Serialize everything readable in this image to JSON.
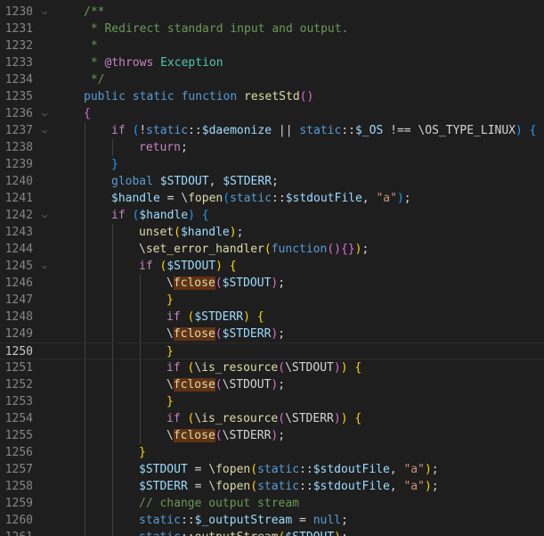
{
  "editor": {
    "language": "php",
    "current_line": 1250,
    "highlight_word": "fclose",
    "colors": {
      "background": "#1e1e1e",
      "comment": "#6a9955",
      "keyword": "#569cd6",
      "control": "#c586c0",
      "function": "#dcdcaa",
      "variable": "#9cdcfe",
      "string": "#ce9178",
      "bracket_1": "#ffd700",
      "bracket_2": "#da70d6",
      "bracket_3": "#179fff",
      "word_highlight": "#613214"
    },
    "lines": [
      {
        "n": "1230",
        "fold": "v",
        "indent": 1,
        "tokens": [
          [
            "comment",
            "/**"
          ]
        ]
      },
      {
        "n": "1231",
        "fold": "",
        "indent": 1,
        "tokens": [
          [
            "comment",
            " * Redirect standard input and output."
          ]
        ]
      },
      {
        "n": "1232",
        "fold": "",
        "indent": 1,
        "tokens": [
          [
            "comment",
            " *"
          ]
        ]
      },
      {
        "n": "1233",
        "fold": "",
        "indent": 1,
        "tokens": [
          [
            "comment",
            " * "
          ],
          [
            "ctl",
            "@throws"
          ],
          [
            "cls",
            " Exception"
          ]
        ]
      },
      {
        "n": "1234",
        "fold": "",
        "indent": 1,
        "tokens": [
          [
            "comment",
            " */"
          ]
        ]
      },
      {
        "n": "1235",
        "fold": "",
        "indent": 1,
        "tokens": [
          [
            "kw",
            "public"
          ],
          [
            "plain",
            " "
          ],
          [
            "kw",
            "static"
          ],
          [
            "plain",
            " "
          ],
          [
            "kw",
            "function"
          ],
          [
            "plain",
            " "
          ],
          [
            "fn",
            "resetStd"
          ],
          [
            "b2",
            "()"
          ]
        ]
      },
      {
        "n": "1236",
        "fold": "v",
        "indent": 1,
        "tokens": [
          [
            "b2",
            "{"
          ]
        ]
      },
      {
        "n": "1237",
        "fold": "v",
        "indent": 2,
        "tokens": [
          [
            "ctl",
            "if"
          ],
          [
            "plain",
            " "
          ],
          [
            "b3",
            "("
          ],
          [
            "plain",
            "!"
          ],
          [
            "kw",
            "static"
          ],
          [
            "plain",
            "::"
          ],
          [
            "var",
            "$daemonize"
          ],
          [
            "plain",
            " || "
          ],
          [
            "kw",
            "static"
          ],
          [
            "plain",
            "::"
          ],
          [
            "var",
            "$_OS"
          ],
          [
            "plain",
            " !== \\OS_TYPE_LINUX"
          ],
          [
            "b3",
            ")"
          ],
          [
            "plain",
            " "
          ],
          [
            "b3",
            "{"
          ]
        ]
      },
      {
        "n": "1238",
        "fold": "",
        "indent": 3,
        "tokens": [
          [
            "ctl",
            "return"
          ],
          [
            "plain",
            ";"
          ]
        ]
      },
      {
        "n": "1239",
        "fold": "",
        "indent": 2,
        "tokens": [
          [
            "b3",
            "}"
          ]
        ]
      },
      {
        "n": "1240",
        "fold": "",
        "indent": 2,
        "tokens": [
          [
            "kw",
            "global"
          ],
          [
            "plain",
            " "
          ],
          [
            "var",
            "$STDOUT"
          ],
          [
            "plain",
            ", "
          ],
          [
            "var",
            "$STDERR"
          ],
          [
            "plain",
            ";"
          ]
        ]
      },
      {
        "n": "1241",
        "fold": "",
        "indent": 2,
        "tokens": [
          [
            "var",
            "$handle"
          ],
          [
            "plain",
            " = \\"
          ],
          [
            "fn",
            "fopen"
          ],
          [
            "b3",
            "("
          ],
          [
            "kw",
            "static"
          ],
          [
            "plain",
            "::"
          ],
          [
            "var",
            "$stdoutFile"
          ],
          [
            "plain",
            ", "
          ],
          [
            "str",
            "\"a\""
          ],
          [
            "b3",
            ")"
          ],
          [
            "plain",
            ";"
          ]
        ]
      },
      {
        "n": "1242",
        "fold": "v",
        "indent": 2,
        "tokens": [
          [
            "ctl",
            "if"
          ],
          [
            "plain",
            " "
          ],
          [
            "b3",
            "("
          ],
          [
            "var",
            "$handle"
          ],
          [
            "b3",
            ")"
          ],
          [
            "plain",
            " "
          ],
          [
            "b3",
            "{"
          ]
        ]
      },
      {
        "n": "1243",
        "fold": "",
        "indent": 3,
        "tokens": [
          [
            "fn",
            "unset"
          ],
          [
            "b1",
            "("
          ],
          [
            "var",
            "$handle"
          ],
          [
            "b1",
            ")"
          ],
          [
            "plain",
            ";"
          ]
        ]
      },
      {
        "n": "1244",
        "fold": "",
        "indent": 3,
        "tokens": [
          [
            "plain",
            "\\"
          ],
          [
            "fn",
            "set_error_handler"
          ],
          [
            "b1",
            "("
          ],
          [
            "kw",
            "function"
          ],
          [
            "b2",
            "()"
          ],
          [
            "b2",
            "{}"
          ],
          [
            "b1",
            ")"
          ],
          [
            "plain",
            ";"
          ]
        ]
      },
      {
        "n": "1245",
        "fold": "v",
        "indent": 3,
        "tokens": [
          [
            "ctl",
            "if"
          ],
          [
            "plain",
            " "
          ],
          [
            "b1",
            "("
          ],
          [
            "var",
            "$STDOUT"
          ],
          [
            "b1",
            ")"
          ],
          [
            "plain",
            " "
          ],
          [
            "b1",
            "{"
          ]
        ]
      },
      {
        "n": "1246",
        "fold": "",
        "indent": 4,
        "tokens": [
          [
            "plain",
            "\\"
          ],
          [
            "hlfn",
            "fclose"
          ],
          [
            "b2",
            "("
          ],
          [
            "var",
            "$STDOUT"
          ],
          [
            "b2",
            ")"
          ],
          [
            "plain",
            ";"
          ]
        ]
      },
      {
        "n": "1247",
        "fold": "",
        "indent": 4,
        "tokens": [
          [
            "b1",
            "}"
          ]
        ]
      },
      {
        "n": "1248",
        "fold": "",
        "indent": 4,
        "tokens": [
          [
            "ctl",
            "if"
          ],
          [
            "plain",
            " "
          ],
          [
            "b1",
            "("
          ],
          [
            "var",
            "$STDERR"
          ],
          [
            "b1",
            ")"
          ],
          [
            "plain",
            " "
          ],
          [
            "b1",
            "{"
          ]
        ]
      },
      {
        "n": "1249",
        "fold": "",
        "indent": 4,
        "tokens": [
          [
            "plain",
            "\\"
          ],
          [
            "hlfn",
            "fclose"
          ],
          [
            "b2",
            "("
          ],
          [
            "var",
            "$STDERR"
          ],
          [
            "b2",
            ")"
          ],
          [
            "plain",
            ";"
          ]
        ]
      },
      {
        "n": "1250",
        "fold": "",
        "indent": 4,
        "tokens": [
          [
            "b1",
            "}"
          ]
        ]
      },
      {
        "n": "1251",
        "fold": "",
        "indent": 4,
        "tokens": [
          [
            "ctl",
            "if"
          ],
          [
            "plain",
            " "
          ],
          [
            "b1",
            "("
          ],
          [
            "plain",
            "\\"
          ],
          [
            "fn",
            "is_resource"
          ],
          [
            "b2",
            "("
          ],
          [
            "plain",
            "\\STDOUT"
          ],
          [
            "b2",
            ")"
          ],
          [
            "b1",
            ")"
          ],
          [
            "plain",
            " "
          ],
          [
            "b1",
            "{"
          ]
        ]
      },
      {
        "n": "1252",
        "fold": "",
        "indent": 4,
        "tokens": [
          [
            "plain",
            "\\"
          ],
          [
            "hlfn",
            "fclose"
          ],
          [
            "b2",
            "("
          ],
          [
            "plain",
            "\\STDOUT"
          ],
          [
            "b2",
            ")"
          ],
          [
            "plain",
            ";"
          ]
        ]
      },
      {
        "n": "1253",
        "fold": "",
        "indent": 4,
        "tokens": [
          [
            "b1",
            "}"
          ]
        ]
      },
      {
        "n": "1254",
        "fold": "",
        "indent": 4,
        "tokens": [
          [
            "ctl",
            "if"
          ],
          [
            "plain",
            " "
          ],
          [
            "b1",
            "("
          ],
          [
            "plain",
            "\\"
          ],
          [
            "fn",
            "is_resource"
          ],
          [
            "b2",
            "("
          ],
          [
            "plain",
            "\\STDERR"
          ],
          [
            "b2",
            ")"
          ],
          [
            "b1",
            ")"
          ],
          [
            "plain",
            " "
          ],
          [
            "b1",
            "{"
          ]
        ]
      },
      {
        "n": "1255",
        "fold": "",
        "indent": 4,
        "tokens": [
          [
            "plain",
            "\\"
          ],
          [
            "hlfn",
            "fclose"
          ],
          [
            "b2",
            "("
          ],
          [
            "plain",
            "\\STDERR"
          ],
          [
            "b2",
            ")"
          ],
          [
            "plain",
            ";"
          ]
        ]
      },
      {
        "n": "1256",
        "fold": "",
        "indent": 3,
        "tokens": [
          [
            "b1",
            "}"
          ]
        ]
      },
      {
        "n": "1257",
        "fold": "",
        "indent": 3,
        "tokens": [
          [
            "var",
            "$STDOUT"
          ],
          [
            "plain",
            " = \\"
          ],
          [
            "fn",
            "fopen"
          ],
          [
            "b1",
            "("
          ],
          [
            "kw",
            "static"
          ],
          [
            "plain",
            "::"
          ],
          [
            "var",
            "$stdoutFile"
          ],
          [
            "plain",
            ", "
          ],
          [
            "str",
            "\"a\""
          ],
          [
            "b1",
            ")"
          ],
          [
            "plain",
            ";"
          ]
        ]
      },
      {
        "n": "1258",
        "fold": "",
        "indent": 3,
        "tokens": [
          [
            "var",
            "$STDERR"
          ],
          [
            "plain",
            " = \\"
          ],
          [
            "fn",
            "fopen"
          ],
          [
            "b1",
            "("
          ],
          [
            "kw",
            "static"
          ],
          [
            "plain",
            "::"
          ],
          [
            "var",
            "$stdoutFile"
          ],
          [
            "plain",
            ", "
          ],
          [
            "str",
            "\"a\""
          ],
          [
            "b1",
            ")"
          ],
          [
            "plain",
            ";"
          ]
        ]
      },
      {
        "n": "1259",
        "fold": "",
        "indent": 3,
        "tokens": [
          [
            "comment",
            "// change output stream"
          ]
        ]
      },
      {
        "n": "1260",
        "fold": "",
        "indent": 3,
        "tokens": [
          [
            "kw",
            "static"
          ],
          [
            "plain",
            "::"
          ],
          [
            "var",
            "$_outputStream"
          ],
          [
            "plain",
            " = "
          ],
          [
            "kw",
            "null"
          ],
          [
            "plain",
            ";"
          ]
        ]
      },
      {
        "n": "1261",
        "fold": "",
        "indent": 3,
        "tokens": [
          [
            "kw",
            "static"
          ],
          [
            "plain",
            "::"
          ],
          [
            "fn",
            "outputStream"
          ],
          [
            "b1",
            "("
          ],
          [
            "var",
            "$STDOUT"
          ],
          [
            "b1",
            ")"
          ],
          [
            "plain",
            ";"
          ]
        ]
      }
    ]
  }
}
